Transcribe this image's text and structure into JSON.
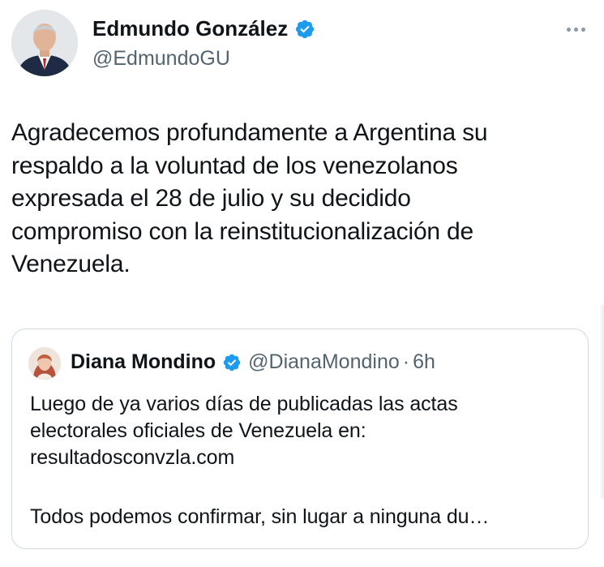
{
  "tweet": {
    "author_name": "Edmundo González",
    "author_handle": "@EdmundoGU",
    "text_lines": [
      "Agradecemos profundamente a Argentina su",
      "respaldo a la voluntad de los venezolanos",
      "expresada el 28 de julio y su decidido",
      "compromiso con la reinstitucionalización de",
      "Venezuela."
    ]
  },
  "quote": {
    "author_name": "Diana Mondino",
    "author_handle": "@DianaMondino",
    "separator": "·",
    "time": "6h",
    "lines": [
      "Luego de ya varios días de publicadas las actas",
      "electorales oficiales de Venezuela en:",
      "resultadosconvzla.com"
    ],
    "truncated_line": "Todos podemos confirmar, sin lugar a ninguna du…"
  },
  "colors": {
    "verified_blue": "#1d9bf0",
    "text_primary": "#0f1419",
    "text_secondary": "#536471",
    "border": "#cfd9de"
  },
  "icons": {
    "verified": "verified-badge-icon",
    "more": "more-options-icon"
  }
}
